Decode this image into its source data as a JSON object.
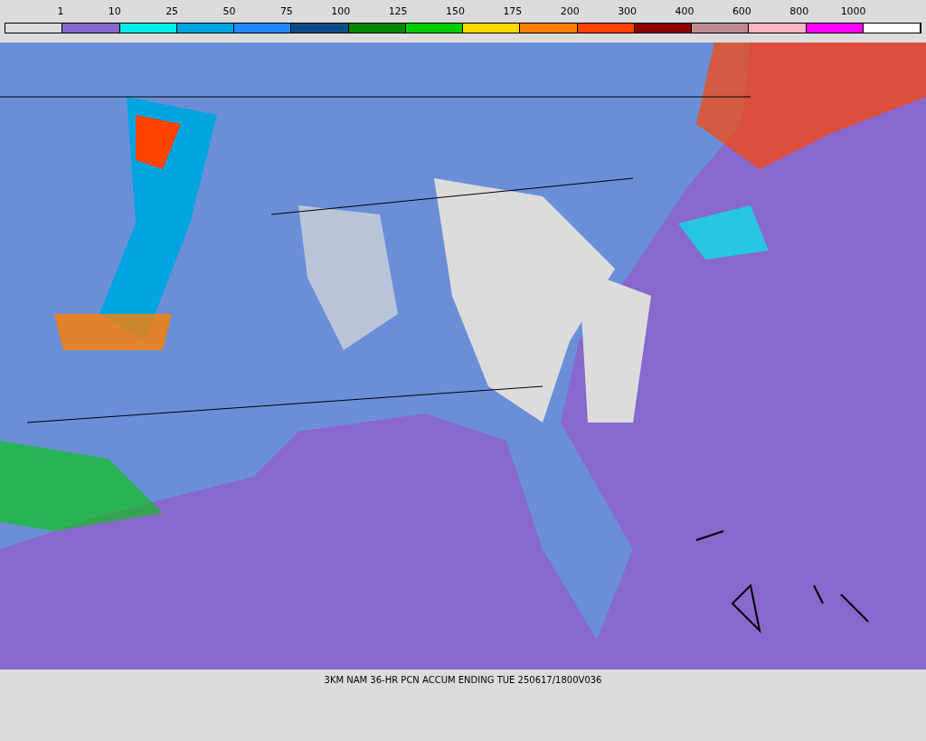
{
  "legend": {
    "segments": [
      {
        "color": "#dcdcdc"
      },
      {
        "color": "#8868cc"
      },
      {
        "color": "#00ece8"
      },
      {
        "color": "#00a4e0"
      },
      {
        "color": "#1e8cff"
      },
      {
        "color": "#104c8c"
      },
      {
        "color": "#008800"
      },
      {
        "color": "#00cc00"
      },
      {
        "color": "#ffd800"
      },
      {
        "color": "#ff8000"
      },
      {
        "color": "#ff4400"
      },
      {
        "color": "#8c0000"
      },
      {
        "color": "#bc8c8c"
      },
      {
        "color": "#ffb4c4"
      },
      {
        "color": "#ff00ff"
      },
      {
        "color": "#ffffff"
      }
    ],
    "labels": [
      "1",
      "10",
      "25",
      "50",
      "75",
      "100",
      "125",
      "150",
      "175",
      "200",
      "300",
      "400",
      "600",
      "800",
      "1000"
    ]
  },
  "caption": "3KM NAM 36-HR PCN ACCUM ENDING TUE 250617/1800V036"
}
